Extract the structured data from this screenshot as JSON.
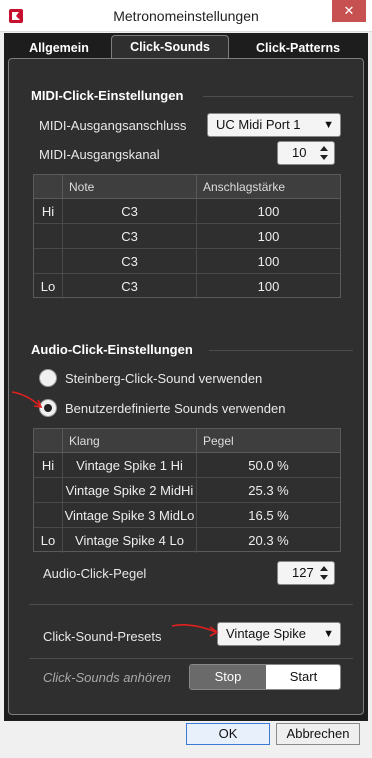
{
  "window": {
    "title": "Metronomeinstellungen",
    "close_glyph": "✕",
    "app_icon": "cubase-icon"
  },
  "tabs": [
    {
      "label": "Allgemein",
      "active": false
    },
    {
      "label": "Click-Sounds",
      "active": true
    },
    {
      "label": "Click-Patterns",
      "active": false
    }
  ],
  "midi": {
    "section_title": "MIDI-Click-Einstellungen",
    "port_label": "MIDI-Ausgangsanschluss",
    "port_value": "UC Midi Port 1",
    "channel_label": "MIDI-Ausgangskanal",
    "channel_value": "10",
    "columns": [
      "Note",
      "Anschlagstärke"
    ],
    "rows": [
      {
        "tag": "Hi",
        "note": "C3",
        "velocity": "100"
      },
      {
        "tag": "",
        "note": "C3",
        "velocity": "100"
      },
      {
        "tag": "",
        "note": "C3",
        "velocity": "100"
      },
      {
        "tag": "Lo",
        "note": "C3",
        "velocity": "100"
      }
    ]
  },
  "audio": {
    "section_title": "Audio-Click-Einstellungen",
    "radio_steinberg": "Steinberg-Click-Sound verwenden",
    "radio_custom": "Benutzerdefinierte Sounds verwenden",
    "selected": "custom",
    "columns": [
      "Klang",
      "Pegel"
    ],
    "rows": [
      {
        "tag": "Hi",
        "sound": "Vintage Spike 1 Hi",
        "level": "50.0 %"
      },
      {
        "tag": "",
        "sound": "Vintage Spike 2 MidHi",
        "level": "25.3 %"
      },
      {
        "tag": "",
        "sound": "Vintage Spike 3 MidLo",
        "level": "16.5 %"
      },
      {
        "tag": "Lo",
        "sound": "Vintage Spike 4 Lo",
        "level": "20.3 %"
      }
    ],
    "level_label": "Audio-Click-Pegel",
    "level_value": "127"
  },
  "presets": {
    "label": "Click-Sound-Presets",
    "value": "Vintage Spike"
  },
  "listen": {
    "label": "Click-Sounds anhören",
    "stop": "Stop",
    "start": "Start"
  },
  "buttons": {
    "ok": "OK",
    "cancel": "Abbrechen"
  },
  "colors": {
    "background": "#2f2f2f",
    "annotation_arrow": "#e0201f"
  }
}
